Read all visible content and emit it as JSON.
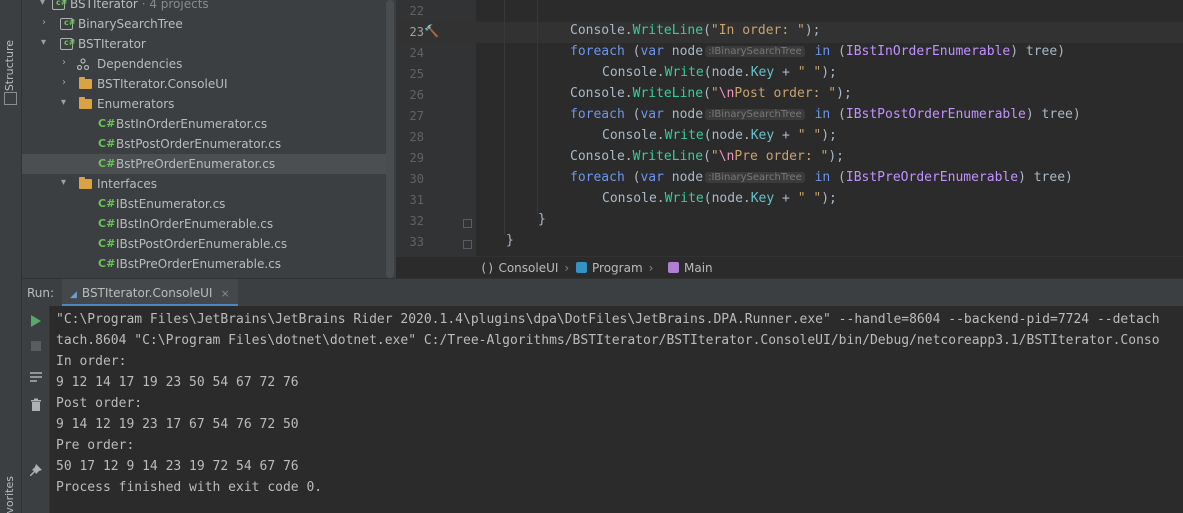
{
  "tool_strip": {
    "structure_label": "Structure",
    "favorites_label": "vorites"
  },
  "project_tree": {
    "root": {
      "label": "BSTIterator",
      "sub": " · 4 projects"
    },
    "items": [
      {
        "label": "BinarySearchTree",
        "kind": "project"
      },
      {
        "label": "BSTIterator",
        "kind": "project"
      },
      {
        "label": "Dependencies",
        "kind": "dependencies"
      },
      {
        "label": "BSTIterator.ConsoleUI",
        "kind": "project"
      },
      {
        "label": "Enumerators",
        "kind": "folder"
      },
      {
        "label": "BstInOrderEnumerator.cs",
        "kind": "csharp-file"
      },
      {
        "label": "BstPostOrderEnumerator.cs",
        "kind": "csharp-file"
      },
      {
        "label": "BstPreOrderEnumerator.cs",
        "kind": "csharp-file",
        "selected": true
      },
      {
        "label": "Interfaces",
        "kind": "folder"
      },
      {
        "label": "IBstEnumerator.cs",
        "kind": "csharp-file"
      },
      {
        "label": "IBstInOrderEnumerable.cs",
        "kind": "csharp-file"
      },
      {
        "label": "IBstPostOrderEnumerable.cs",
        "kind": "csharp-file"
      },
      {
        "label": "IBstPreOrderEnumerable.cs",
        "kind": "csharp-file"
      }
    ],
    "cs_badge": "C#"
  },
  "editor": {
    "line_numbers": [
      "22",
      "23",
      "24",
      "25",
      "26",
      "27",
      "28",
      "29",
      "30",
      "31",
      "32",
      "33"
    ],
    "current_line": "23",
    "type_hint": ":IBinarySearchTree"
  },
  "breadcrumb": {
    "items": [
      "ConsoleUI",
      "Program",
      "Main"
    ],
    "namespace_icon": "()"
  },
  "run_panel": {
    "label": "Run:",
    "tab_label": "BSTIterator.ConsoleUI",
    "tab_close": "×"
  },
  "console": {
    "lines": [
      "\"C:\\Program Files\\JetBrains\\JetBrains Rider 2020.1.4\\plugins\\dpa\\DotFiles\\JetBrains.DPA.Runner.exe\" --handle=8604 --backend-pid=7724 --detach",
      "tach.8604 \"C:\\Program Files\\dotnet\\dotnet.exe\" C:/Tree-Algorithms/BSTIterator/BSTIterator.ConsoleUI/bin/Debug/netcoreapp3.1/BSTIterator.Conso",
      "In order:",
      "9 12 14 17 19 23 50 54 67 72 76",
      "Post order:",
      "9 14 12 19 23 17 67 54 76 72 50",
      "Pre order:",
      "50 17 12 9 14 23 19 72 54 67 76",
      "Process finished with exit code 0."
    ]
  },
  "colors": {
    "panel_bg": "#3c3f41",
    "editor_bg": "#2b2b2b",
    "accent": "#4a88c7",
    "run_green": "#59a869"
  }
}
